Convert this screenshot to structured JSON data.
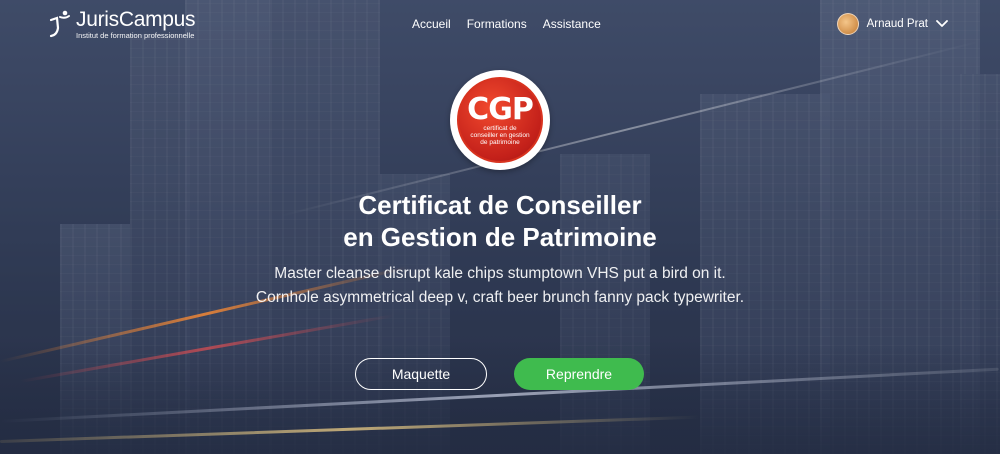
{
  "brand": {
    "name": "JurisCampus",
    "tagline": "Institut de formation professionnelle"
  },
  "nav": {
    "items": [
      {
        "label": "Accueil"
      },
      {
        "label": "Formations"
      },
      {
        "label": "Assistance"
      }
    ]
  },
  "user": {
    "name": "Arnaud Prat",
    "menu_icon": "chevron-down-icon"
  },
  "course": {
    "badge_acronym": "CGP",
    "badge_text": "certificat de conseiller en gestion de patrimoine",
    "title_line1": "Certificat de Conseiller",
    "title_line2": "en Gestion de Patrimoine",
    "description_line1": "Master cleanse disrupt kale chips stumptown VHS put a bird on it.",
    "description_line2": "Cornhole asymmetrical deep v, craft beer brunch fanny pack typewriter."
  },
  "actions": {
    "secondary_label": "Maquette",
    "primary_label": "Reprendre"
  },
  "colors": {
    "primary_button": "#3fbb4e",
    "badge_red": "#c3201a"
  }
}
